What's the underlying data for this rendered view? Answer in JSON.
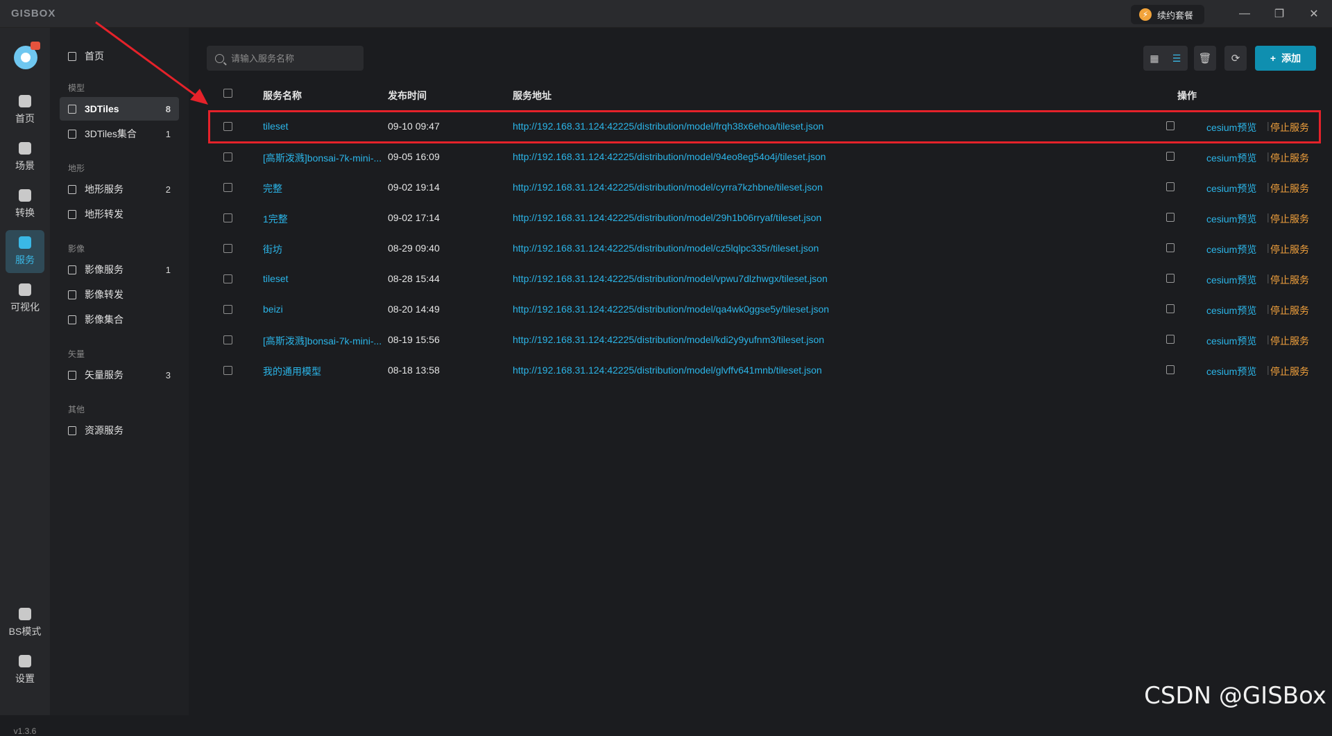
{
  "app": {
    "logo": "GISBOX",
    "renew_label": "续约套餐",
    "version": "v1.3.6"
  },
  "rail": [
    {
      "label": "首页",
      "icon": "home-icon"
    },
    {
      "label": "场景",
      "icon": "scene-icon"
    },
    {
      "label": "转换",
      "icon": "convert-icon"
    },
    {
      "label": "服务",
      "icon": "service-icon",
      "active": true
    },
    {
      "label": "可视化",
      "icon": "visual-icon"
    },
    {
      "label": "BS模式",
      "icon": "bs-mode-icon"
    },
    {
      "label": "设置",
      "icon": "settings-icon"
    }
  ],
  "sidebar": {
    "home": "首页",
    "groups": [
      {
        "title": "模型",
        "items": [
          {
            "label": "3DTiles",
            "count": "8",
            "active": true
          },
          {
            "label": "3DTiles集合",
            "count": "1"
          }
        ]
      },
      {
        "title": "地形",
        "items": [
          {
            "label": "地形服务",
            "count": "2"
          },
          {
            "label": "地形转发",
            "count": ""
          }
        ]
      },
      {
        "title": "影像",
        "items": [
          {
            "label": "影像服务",
            "count": "1"
          },
          {
            "label": "影像转发",
            "count": ""
          },
          {
            "label": "影像集合",
            "count": ""
          }
        ]
      },
      {
        "title": "矢量",
        "items": [
          {
            "label": "矢量服务",
            "count": "3"
          }
        ]
      },
      {
        "title": "其他",
        "items": [
          {
            "label": "资源服务",
            "count": ""
          }
        ]
      }
    ]
  },
  "toolbar": {
    "search_placeholder": "请输入服务名称",
    "add_label": "添加"
  },
  "table": {
    "headers": {
      "name": "服务名称",
      "time": "发布时间",
      "url": "服务地址",
      "ops": "操作"
    },
    "preview_label": "cesium预览",
    "stop_label": "停止服务",
    "rows": [
      {
        "name": "tileset",
        "time": "09-10 09:47",
        "url": "http://192.168.31.124:42225/distribution/model/frqh38x6ehoa/tileset.json"
      },
      {
        "name": "[高斯泼溅]bonsai-7k-mini-...",
        "time": "09-05 16:09",
        "url": "http://192.168.31.124:42225/distribution/model/94eo8eg54o4j/tileset.json"
      },
      {
        "name": "完整",
        "time": "09-02 19:14",
        "url": "http://192.168.31.124:42225/distribution/model/cyrra7kzhbne/tileset.json"
      },
      {
        "name": "1完整",
        "time": "09-02 17:14",
        "url": "http://192.168.31.124:42225/distribution/model/29h1b06rryaf/tileset.json"
      },
      {
        "name": "街坊",
        "time": "08-29 09:40",
        "url": "http://192.168.31.124:42225/distribution/model/cz5lqlpc335r/tileset.json"
      },
      {
        "name": "tileset",
        "time": "08-28 15:44",
        "url": "http://192.168.31.124:42225/distribution/model/vpwu7dlzhwgx/tileset.json"
      },
      {
        "name": "beizi",
        "time": "08-20 14:49",
        "url": "http://192.168.31.124:42225/distribution/model/qa4wk0ggse5y/tileset.json"
      },
      {
        "name": "[高斯泼溅]bonsai-7k-mini-...",
        "time": "08-19 15:56",
        "url": "http://192.168.31.124:42225/distribution/model/kdi2y9yufnm3/tileset.json"
      },
      {
        "name": "我的通用模型",
        "time": "08-18 13:58",
        "url": "http://192.168.31.124:42225/distribution/model/glvffv641mnb/tileset.json"
      }
    ]
  },
  "watermark": "CSDN @GISBox",
  "colors": {
    "accent": "#2bb5e8",
    "stop": "#f0a03c",
    "highlight": "#e5222a"
  }
}
